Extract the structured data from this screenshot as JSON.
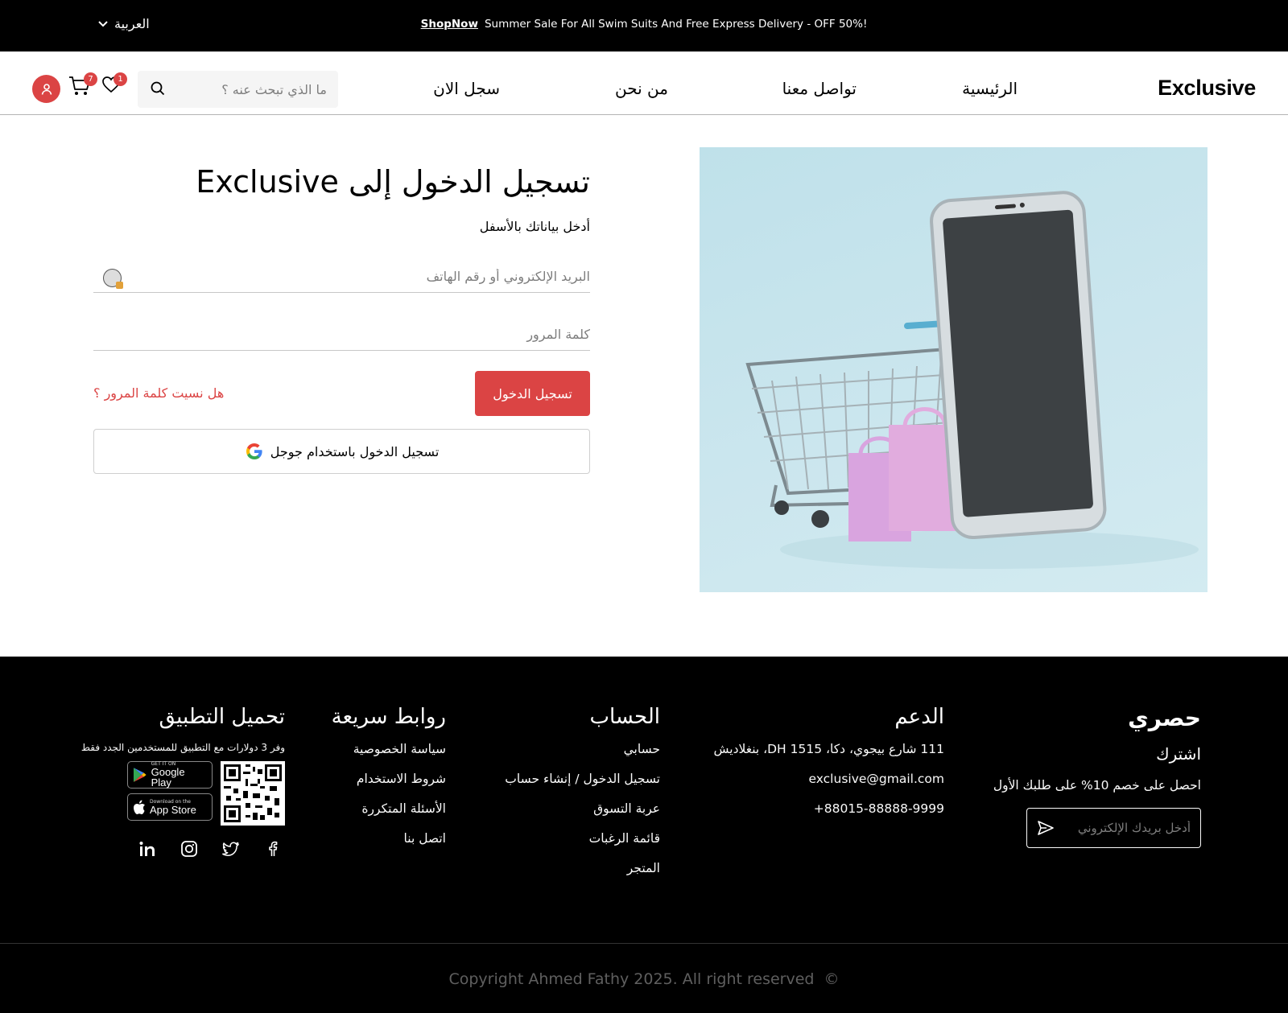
{
  "topbar": {
    "promo_text": "Summer Sale For All Swim Suits And Free Express Delivery - OFF 50%!",
    "shop_now": "ShopNow",
    "language": "العربية"
  },
  "header": {
    "logo": "Exclusive",
    "nav": [
      "الرئيسية",
      "تواصل معنا",
      "من نحن",
      "سجل الان"
    ],
    "search_placeholder": "ما الذي تبحث عنه ؟",
    "cart_count": "7",
    "wishlist_count": "1"
  },
  "login": {
    "title": "تسجيل الدخول إلى Exclusive",
    "subtitle": "أدخل بياناتك بالأسفل",
    "email_placeholder": "البريد الإلكتروني أو رقم الهاتف",
    "password_placeholder": "كلمة المرور",
    "login_button": "تسجيل الدخول",
    "forgot_password": "هل نسيت كلمة المرور ؟",
    "google_button": "تسجيل الدخول باستخدام جوجل"
  },
  "footer": {
    "exclusive": {
      "brand": "حصري",
      "subscribe": "اشترك",
      "offer": "احصل على خصم 10% على طلبك الأول",
      "email_placeholder": "أدخل بريدك الإلكتروني"
    },
    "support": {
      "title": "الدعم",
      "address": "111 شارع بيجوي، دكا، DH 1515، بنغلاديش",
      "email": "exclusive@gmail.com",
      "phone": "+88015-88888-9999"
    },
    "account": {
      "title": "الحساب",
      "items": [
        "حسابي",
        "تسجيل الدخول / إنشاء حساب",
        "عربة التسوق",
        "قائمة الرغبات",
        "المتجر"
      ]
    },
    "quick_links": {
      "title": "روابط سريعة",
      "items": [
        "سياسة الخصوصية",
        "شروط الاستخدام",
        "الأسئلة المتكررة",
        "اتصل بنا"
      ]
    },
    "app": {
      "title": "تحميل التطبيق",
      "note": "وفر 3 دولارات مع التطبيق للمستخدمين الجدد فقط",
      "google_play_small": "GET IT ON",
      "google_play": "Google Play",
      "app_store_small": "Download on the",
      "app_store": "App Store",
      "socials": [
        "facebook-icon",
        "twitter-icon",
        "instagram-icon",
        "linkedin-icon"
      ]
    },
    "copyright": "Copyright Ahmed Fathy 2025. All right reserved"
  },
  "colors": {
    "accent": "#DB4444",
    "topbar_bg": "#000000",
    "footer_bg": "#000000",
    "image_bg": "#C6E4EC"
  }
}
